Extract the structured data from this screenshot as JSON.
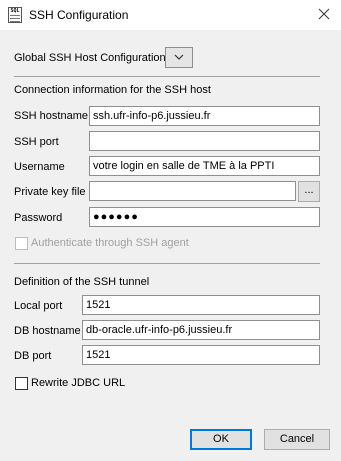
{
  "window": {
    "title": "SSH Configuration",
    "app_icon_text": "SQL"
  },
  "global": {
    "label": "Global SSH Host Configuration"
  },
  "connection": {
    "heading": "Connection information for the SSH host",
    "hostname_label": "SSH hostname",
    "hostname_value": "ssh.ufr-info-p6.jussieu.fr",
    "port_label": "SSH port",
    "port_value": "",
    "username_label": "Username",
    "username_value": "votre login en salle de TME à la PPTI",
    "keyfile_label": "Private key file",
    "keyfile_value": "",
    "browse_label": "...",
    "password_label": "Password",
    "password_value": "●●●●●●",
    "agent_label": "Authenticate through SSH agent",
    "agent_checked": false
  },
  "tunnel": {
    "heading": "Definition of the SSH tunnel",
    "local_port_label": "Local port",
    "local_port_value": "1521",
    "db_host_label": "DB hostname",
    "db_host_value": "db-oracle.ufr-info-p6.jussieu.fr",
    "db_port_label": "DB port",
    "db_port_value": "1521",
    "rewrite_label": "Rewrite JDBC URL",
    "rewrite_checked": false
  },
  "buttons": {
    "ok": "OK",
    "cancel": "Cancel"
  },
  "colors": {
    "accent": "#0078d7",
    "background": "#f0f0f0"
  }
}
